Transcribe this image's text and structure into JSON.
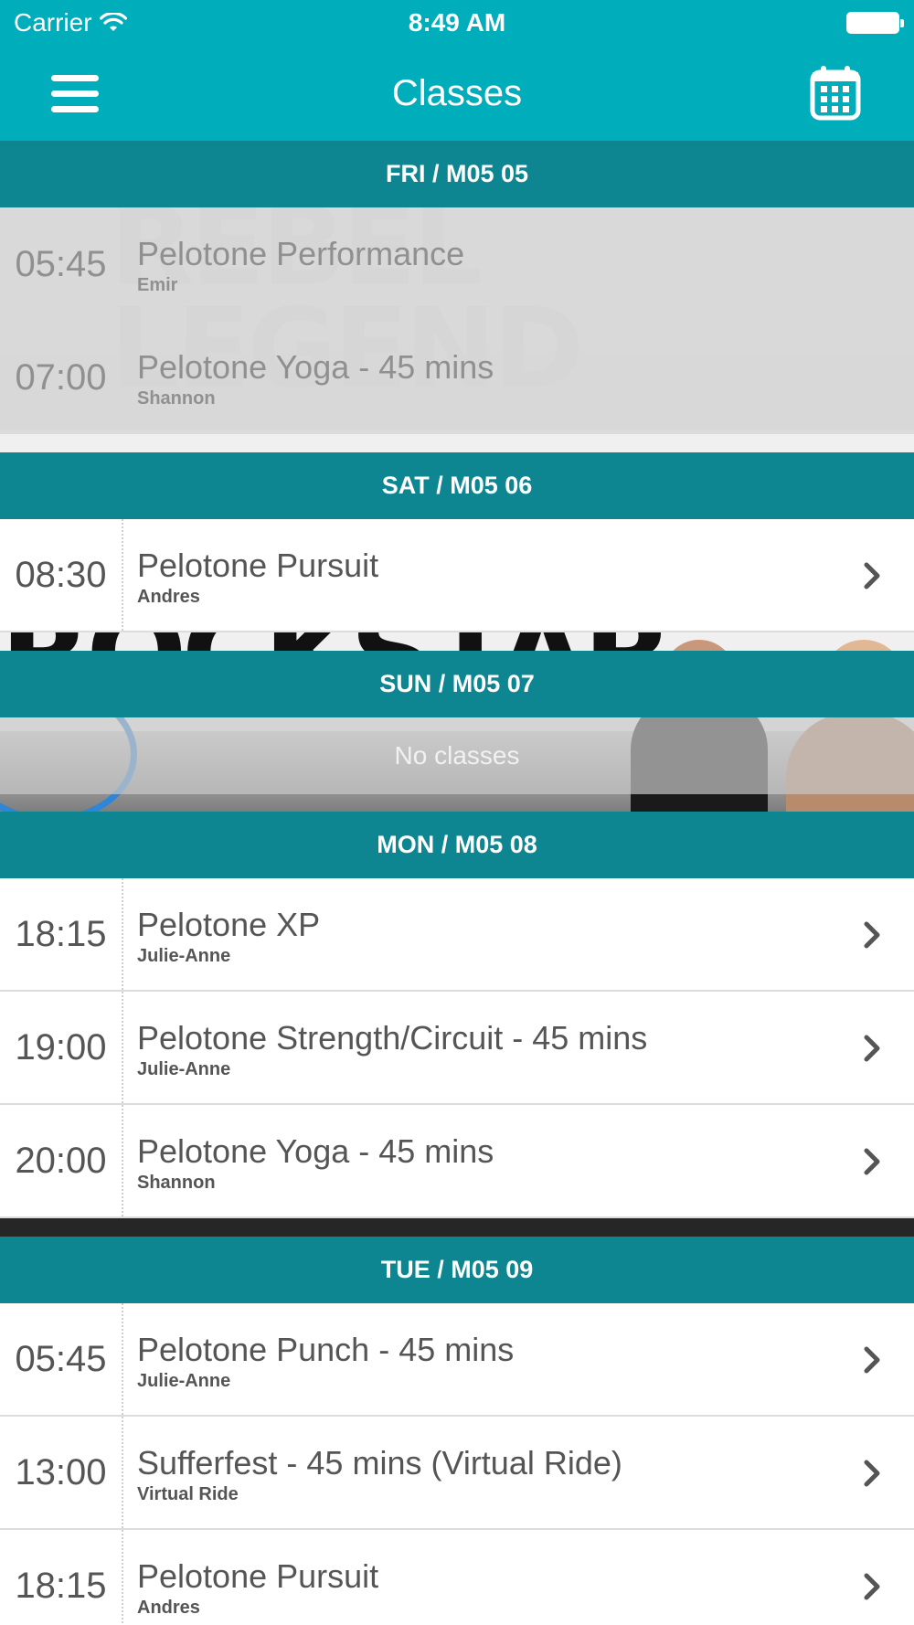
{
  "status_bar": {
    "carrier": "Carrier",
    "time": "8:49 AM"
  },
  "nav": {
    "title": "Classes",
    "menu_icon": "hamburger-menu-icon",
    "calendar_icon": "calendar-icon"
  },
  "colors": {
    "nav_bg": "#00adbb",
    "day_header_bg": "#0e8692"
  },
  "days": [
    {
      "header": "FRI / M05 05",
      "classes": [
        {
          "time": "05:45",
          "name": "Pelotone Performance",
          "instructor": "Emir",
          "past": true
        },
        {
          "time": "07:00",
          "name": "Pelotone Yoga - 45 mins",
          "instructor": "Shannon",
          "past": true
        }
      ]
    },
    {
      "header": "SAT / M05 06",
      "classes": [
        {
          "time": "08:30",
          "name": "Pelotone Pursuit",
          "instructor": "Andres",
          "past": false
        }
      ]
    },
    {
      "header": "SUN / M05 07",
      "empty_text": "No classes",
      "classes": []
    },
    {
      "header": "MON / M05 08",
      "classes": [
        {
          "time": "18:15",
          "name": "Pelotone XP",
          "instructor": "Julie-Anne",
          "past": false
        },
        {
          "time": "19:00",
          "name": "Pelotone Strength/Circuit - 45 mins",
          "instructor": "Julie-Anne",
          "past": false
        },
        {
          "time": "20:00",
          "name": "Pelotone Yoga - 45 mins",
          "instructor": "Shannon",
          "past": false
        }
      ]
    },
    {
      "header": "TUE / M05 09",
      "classes": [
        {
          "time": "05:45",
          "name": "Pelotone Punch - 45 mins",
          "instructor": "Julie-Anne",
          "past": false
        },
        {
          "time": "13:00",
          "name": "Sufferfest - 45 mins (Virtual Ride)",
          "instructor": "Virtual Ride",
          "past": false
        },
        {
          "time": "18:15",
          "name": "Pelotone Pursuit",
          "instructor": "Andres",
          "past": false
        }
      ]
    }
  ]
}
